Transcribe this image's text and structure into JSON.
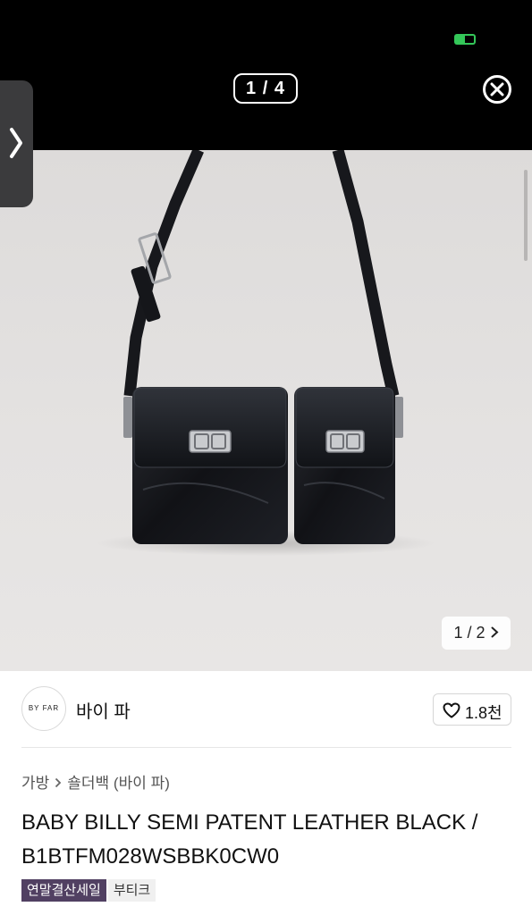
{
  "viewer": {
    "counter": "1 / 4",
    "close_icon": "close-circle-icon",
    "side_tab_icon": "chevron-right-icon",
    "status_color": "#34c759"
  },
  "product": {
    "image_pager": "1 / 2",
    "image_alt": "black patent leather double-pocket shoulder bag",
    "brand": {
      "logo_text": "BY FAR",
      "name": "바이 파",
      "likes": "1.8천"
    },
    "breadcrumb": [
      "가방",
      "숄더백 (바이 파)"
    ],
    "title": "BABY BILLY SEMI PATENT LEATHER BLACK / B1BTFM028WSBBK0CW0",
    "tags": [
      {
        "label": "연말결산세일",
        "color": "#514062"
      },
      {
        "label": "부티크",
        "color": "#f0f0f0"
      }
    ]
  }
}
